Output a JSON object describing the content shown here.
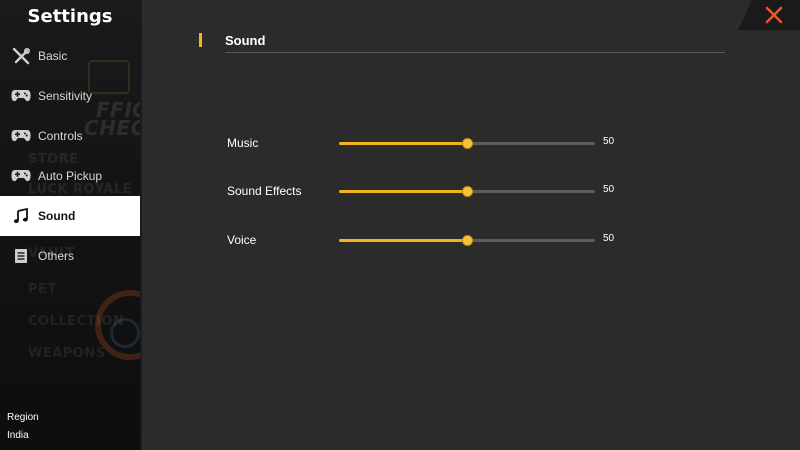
{
  "sidebar": {
    "title": "Settings",
    "items": [
      {
        "label": "Basic",
        "icon": "wrench-screwdriver-icon",
        "active": false
      },
      {
        "label": "Sensitivity",
        "icon": "gamepad-icon",
        "active": false
      },
      {
        "label": "Controls",
        "icon": "gamepad-icon",
        "active": false
      },
      {
        "label": "Auto Pickup",
        "icon": "gamepad-icon",
        "active": false
      },
      {
        "label": "Sound",
        "icon": "music-note-icon",
        "active": true
      },
      {
        "label": "Others",
        "icon": "document-icon",
        "active": false
      }
    ],
    "region_label": "Region",
    "region_value": "India"
  },
  "content": {
    "section_title": "Sound",
    "sliders": [
      {
        "label": "Music",
        "value": 50,
        "max": 100,
        "value_text": "50"
      },
      {
        "label": "Sound Effects",
        "value": 50,
        "max": 100,
        "value_text": "50"
      },
      {
        "label": "Voice",
        "value": 50,
        "max": 100,
        "value_text": "50"
      }
    ]
  },
  "colors": {
    "accent": "#f2b51c",
    "close_icon": "#e8572a",
    "background": "#2b2b2b",
    "sidebar": "#141414"
  },
  "close_button": {
    "icon": "close-icon"
  }
}
